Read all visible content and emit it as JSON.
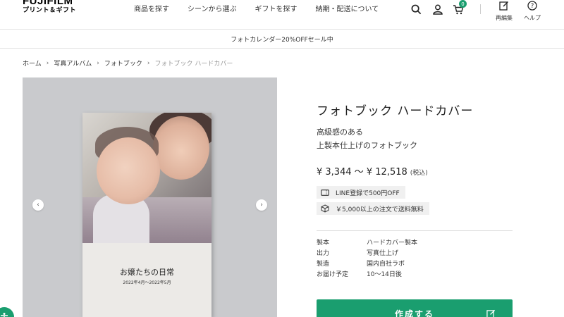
{
  "header": {
    "logo_main": "FUJIFILM",
    "logo_sub": "プリント＆ギフト",
    "nav": [
      "商品を探す",
      "シーンから選ぶ",
      "ギフトを探す",
      "納期・配送について"
    ],
    "cart_count": "0",
    "reorder_label": "再編集",
    "help_label": "ヘルプ"
  },
  "banner": {
    "text": "フォトカレンダー20%OFFセール中"
  },
  "breadcrumb": {
    "items": [
      "ホーム",
      "写真アルバム",
      "フォトブック"
    ],
    "current": "フォトブック ハードカバー"
  },
  "gallery": {
    "book_title": "お嬢たちの日常",
    "book_date": "2022年4月～2022年5月",
    "prev_label": "‹",
    "next_label": "›"
  },
  "product": {
    "title": "フォトブック ハードカバー",
    "desc_line1": "高級感のある",
    "desc_line2": "上製本仕上げのフォトブック",
    "price": "¥ 3,344 ～ ¥ 12,518",
    "tax_note": "(税込)",
    "promo_line": "LINE登録で500円OFF",
    "promo_shipping": "￥5,000以上の注文で送料無料",
    "specs": [
      {
        "key": "製本",
        "value": "ハードカバー製本"
      },
      {
        "key": "出力",
        "value": "写真仕上げ"
      },
      {
        "key": "製造",
        "value": "国内自社ラボ"
      },
      {
        "key": "お届け予定",
        "value": "10〜14日後"
      }
    ],
    "cta_label": "作成する"
  },
  "colors": {
    "accent": "#1a9e6f",
    "banner_border": "#e3e3e3"
  }
}
